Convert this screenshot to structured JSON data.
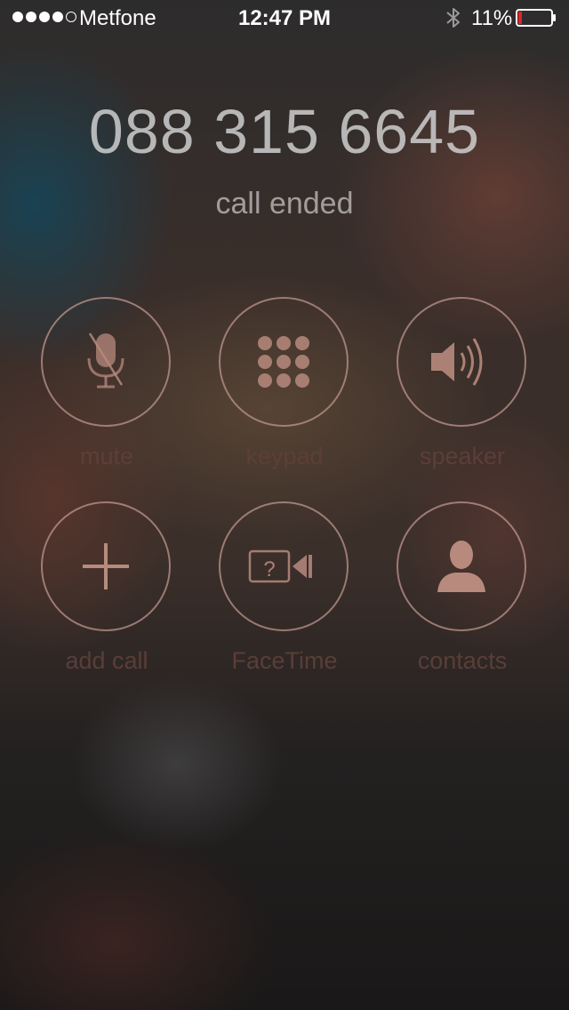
{
  "status_bar": {
    "carrier": "Metfone",
    "time": "12:47 PM",
    "battery_percent": "11%",
    "battery_level": 0.11,
    "signal_bars": 4,
    "signal_max": 5,
    "icons": [
      "signal-dots-icon",
      "bluetooth-icon",
      "battery-icon"
    ]
  },
  "call": {
    "number": "088 315 6645",
    "status": "call ended"
  },
  "controls": {
    "mute": "mute",
    "keypad": "keypad",
    "speaker": "speaker",
    "add_call": "add call",
    "facetime": "FaceTime",
    "contacts": "contacts"
  },
  "colors": {
    "button_ring": "#be968c",
    "icon_fill": "#b88a7e",
    "label": "#5e3f39",
    "battery_low": "#e0242a"
  }
}
